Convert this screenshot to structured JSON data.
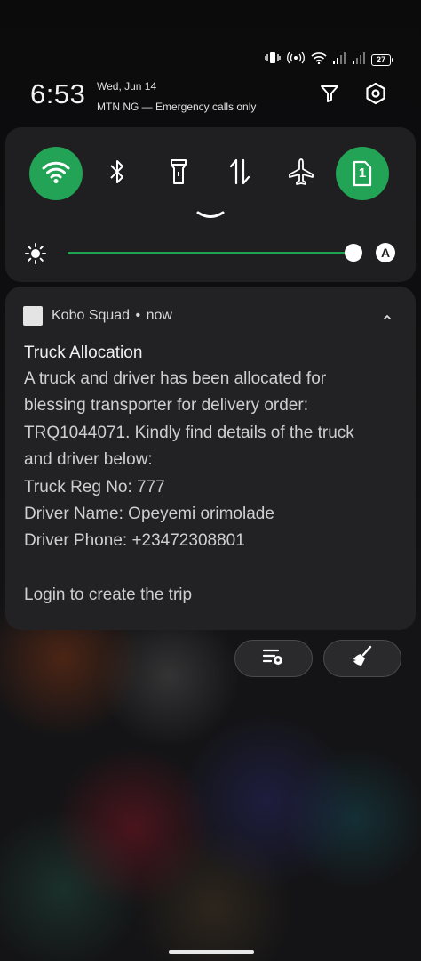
{
  "status_bar": {
    "battery_level": "27",
    "icons": [
      "vibrate-icon",
      "hotspot-icon",
      "wifi-icon",
      "signal-sim1-icon",
      "signal-sim2-icon",
      "battery-icon"
    ]
  },
  "header": {
    "time": "6:53",
    "date": "Wed, Jun 14",
    "carrier": "MTN NG — Emergency calls only",
    "buttons": [
      "filter-icon",
      "settings-icon"
    ]
  },
  "quick_settings": {
    "tiles": [
      {
        "name": "wifi",
        "icon": "wifi-icon",
        "active": true
      },
      {
        "name": "bluetooth",
        "icon": "bluetooth-icon",
        "active": false
      },
      {
        "name": "flashlight",
        "icon": "flashlight-icon",
        "active": false
      },
      {
        "name": "mobile-data",
        "icon": "data-arrows-icon",
        "active": false
      },
      {
        "name": "airplane-mode",
        "icon": "airplane-icon",
        "active": false
      },
      {
        "name": "sim",
        "icon": "sim-icon",
        "label": "1",
        "active": true
      }
    ],
    "brightness": {
      "level_fraction": 1.0,
      "auto_label": "A"
    },
    "accent_color": "#22a356"
  },
  "notification": {
    "app_name": "Kobo Squad",
    "separator": "•",
    "time": "now",
    "title": "Truck Allocation",
    "body_lines": [
      "A truck and driver has been allocated for",
      "blessing transporter for delivery order:",
      "TRQ1044071. Kindly find details of the truck",
      "and driver below:",
      "Truck Reg No: 777",
      "Driver Name: Opeyemi orimolade",
      "Driver Phone: +23472308801"
    ],
    "footer": "Login to create the trip"
  },
  "bottom_actions": [
    {
      "name": "notification-settings",
      "icon": "notification-settings-icon"
    },
    {
      "name": "clear-all",
      "icon": "broom-icon"
    }
  ]
}
